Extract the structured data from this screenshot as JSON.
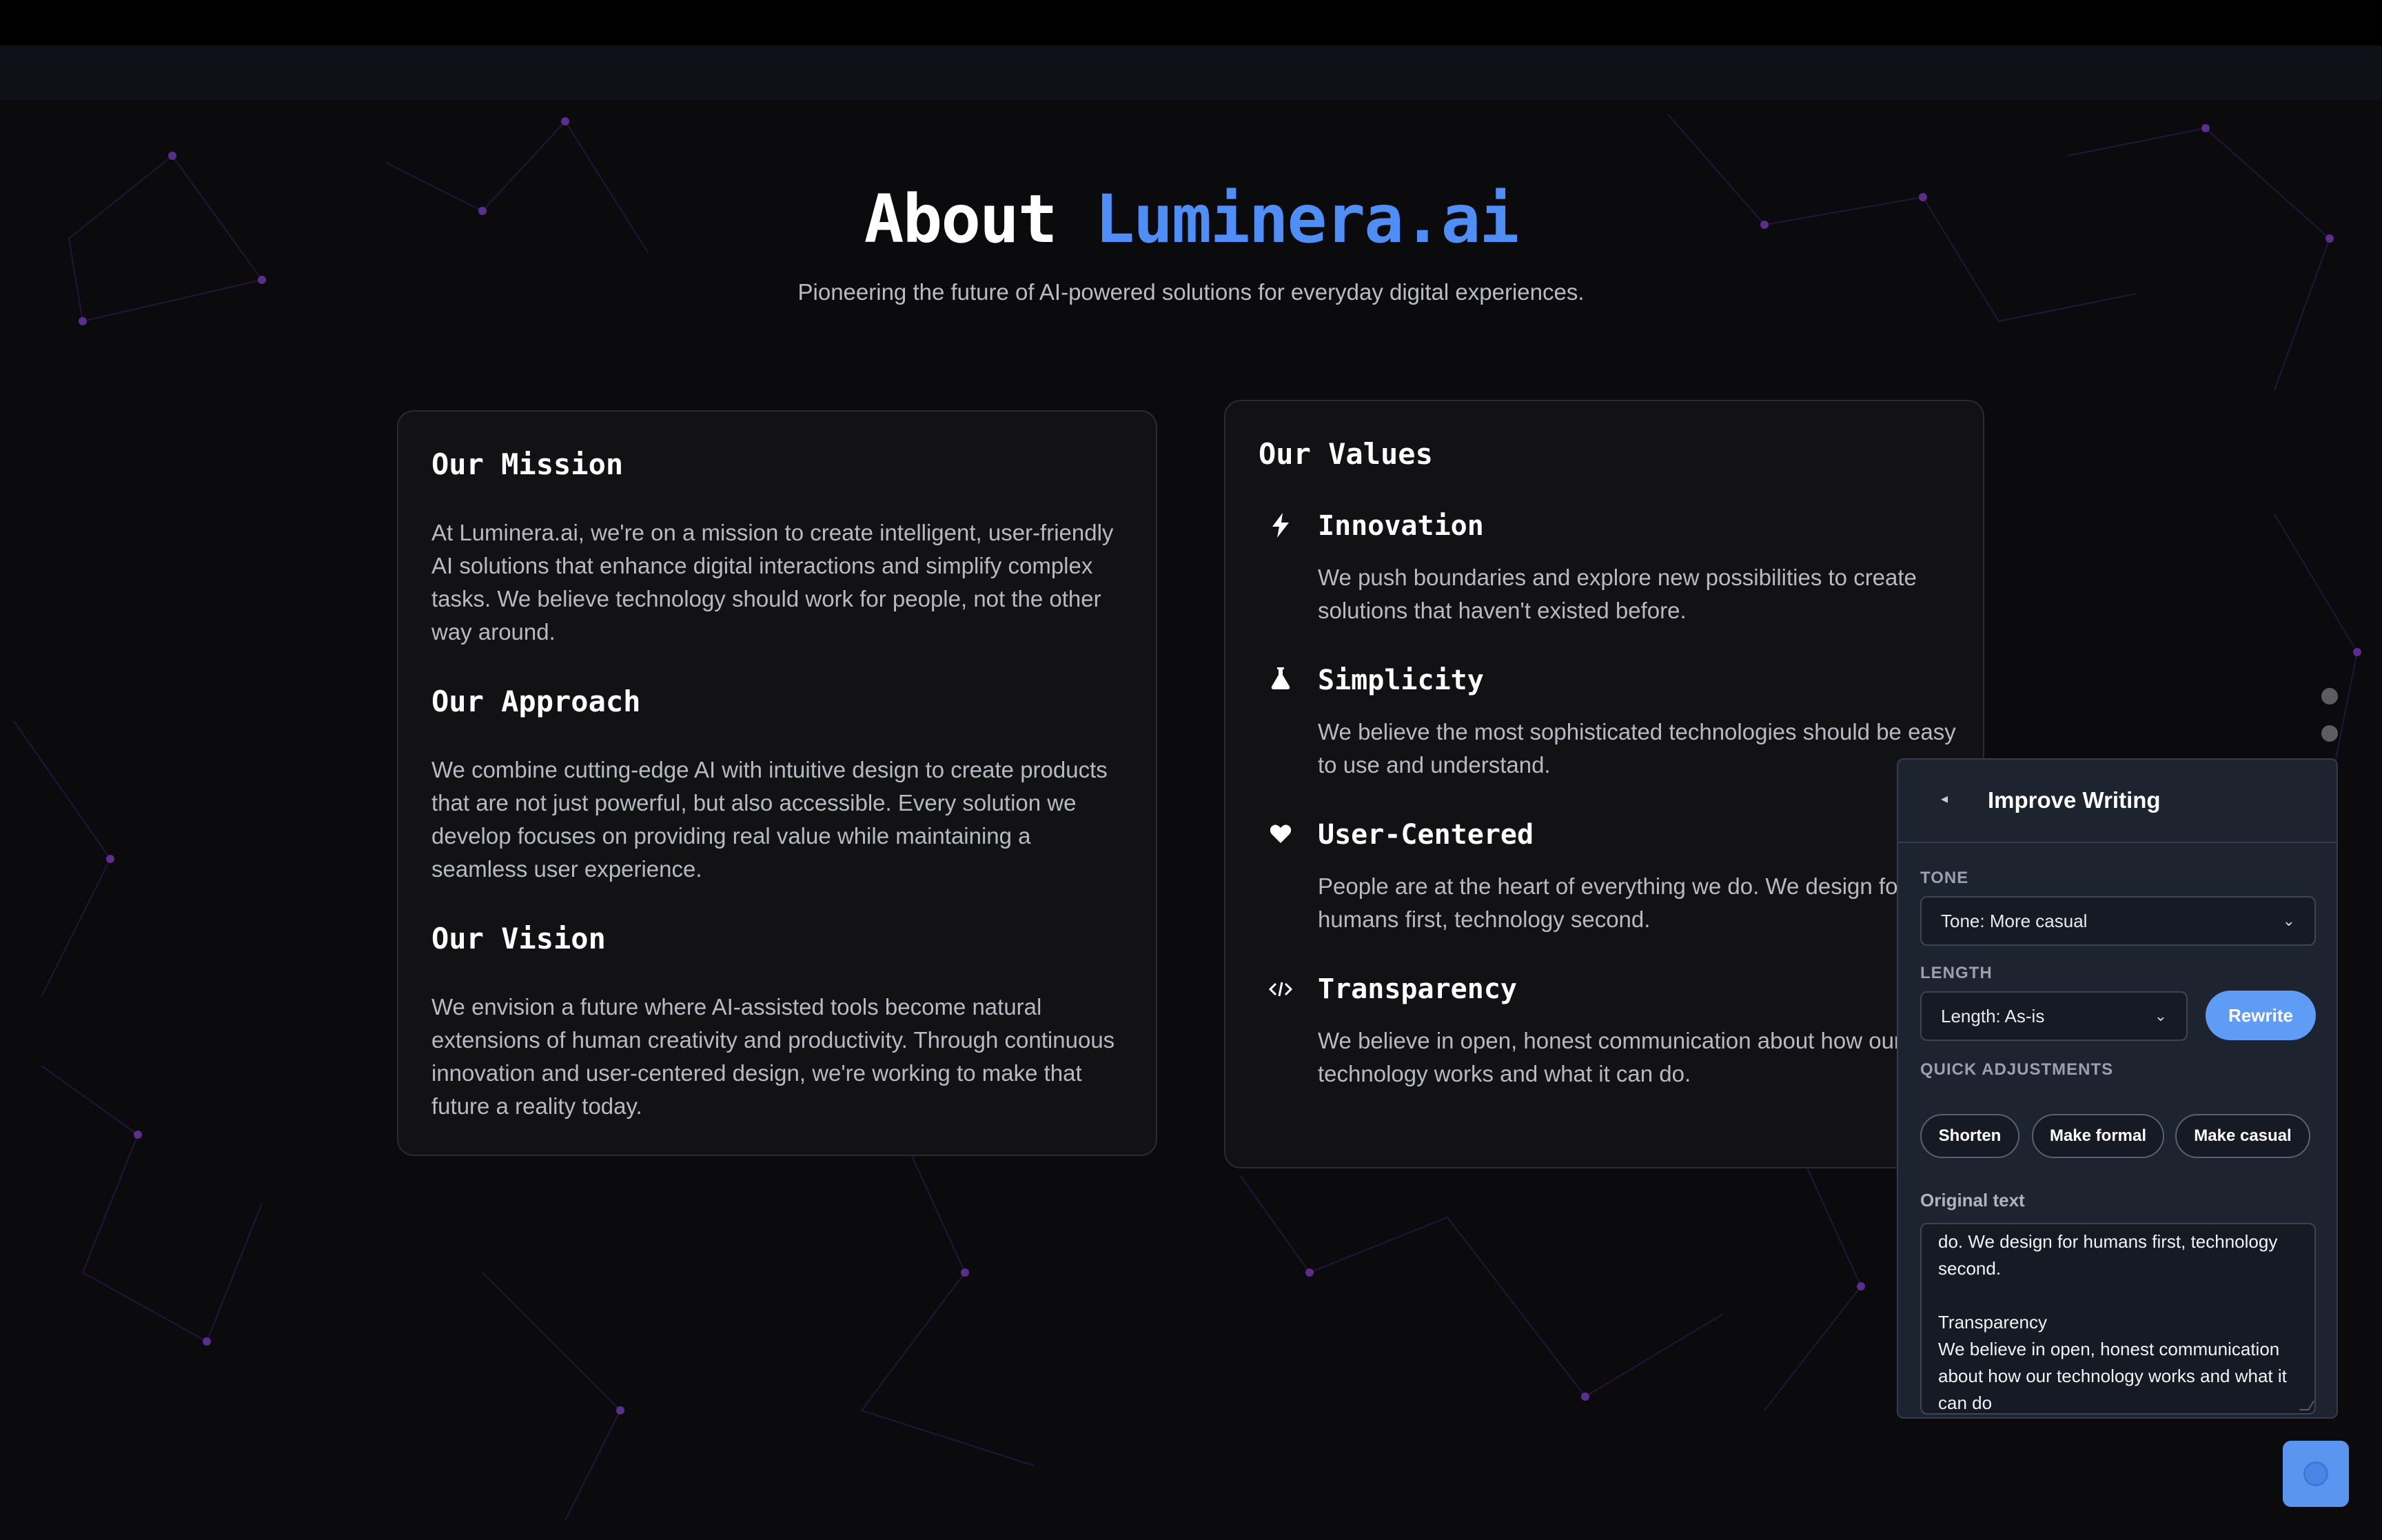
{
  "hero": {
    "title_prefix": "About ",
    "title_brand": "Luminera.ai",
    "subtitle": "Pioneering the future of AI-powered solutions for everyday digital experiences."
  },
  "left_card": {
    "sections": [
      {
        "title": "Our Mission",
        "text": "At Luminera.ai, we're on a mission to create intelligent, user-friendly AI solutions that enhance digital interactions and simplify complex tasks. We believe technology should work for people, not the other way around."
      },
      {
        "title": "Our Approach",
        "text": "We combine cutting-edge AI with intuitive design to create products that are not just powerful, but also accessible. Every solution we develop focuses on providing real value while maintaining a seamless user experience."
      },
      {
        "title": "Our Vision",
        "text": "We envision a future where AI-assisted tools become natural extensions of human creativity and productivity. Through continuous innovation and user-centered design, we're working to make that future a reality today."
      }
    ]
  },
  "right_card": {
    "title": "Our Values",
    "values": [
      {
        "icon": "bolt-icon",
        "title": "Innovation",
        "text": "We push boundaries and explore new possibilities to create solutions that haven't existed before."
      },
      {
        "icon": "flask-icon",
        "title": "Simplicity",
        "text": "We believe the most sophisticated technologies should be easy to use and understand."
      },
      {
        "icon": "heart-icon",
        "title": "User-Centered",
        "text": "People are at the heart of everything we do. We design for humans first, technology second."
      },
      {
        "icon": "code-icon",
        "title": "Transparency",
        "text": "We believe in open, honest communication about how our technology works and what it can do."
      }
    ]
  },
  "panel": {
    "title": "Improve Writing",
    "tone_label": "TONE",
    "tone_value": "Tone: More casual",
    "length_label": "LENGTH",
    "length_value": "Length: As-is",
    "rewrite_label": "Rewrite",
    "quick_label": "QUICK ADJUSTMENTS",
    "chips": [
      "Shorten",
      "Make formal",
      "Make casual"
    ],
    "original_label": "Original text",
    "original_text": "do. We design for humans first, technology second.\n\nTransparency\nWe believe in open, honest communication about how our technology works and what it can do"
  },
  "colors": {
    "brand": "#4f8df7",
    "background": "#0b0b0d",
    "panel": "#1e2330",
    "button": "#5f9cf5"
  }
}
